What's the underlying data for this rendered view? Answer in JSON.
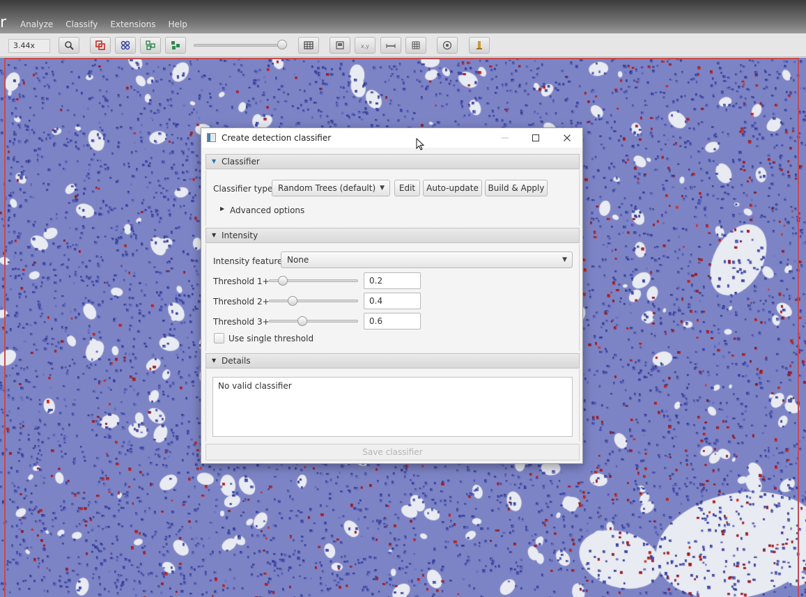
{
  "app": {
    "title_fragment": "r",
    "menu": [
      "Analyze",
      "Classify",
      "Extensions",
      "Help"
    ]
  },
  "toolbar": {
    "zoom": "3.44x",
    "buttons": [
      {
        "icon": "zoom-fit-icon"
      },
      {
        "icon": "show-annotations-icon"
      },
      {
        "icon": "show-tma-grid-icon"
      },
      {
        "icon": "show-detections-icon"
      },
      {
        "icon": "fill-detections-icon"
      },
      {
        "icon": "table-icon"
      },
      {
        "icon": "overview-icon"
      },
      {
        "icon": "xy-location-icon"
      },
      {
        "icon": "scalebar-icon"
      },
      {
        "icon": "grid-icon"
      },
      {
        "icon": "pixel-classification-icon"
      },
      {
        "icon": "log-icon"
      }
    ]
  },
  "dialog": {
    "title": "Create detection classifier",
    "sections": {
      "classifier": {
        "header": "Classifier",
        "type_label": "Classifier type:",
        "type_value": "Random Trees (default)",
        "edit_label": "Edit",
        "auto_update_label": "Auto-update",
        "build_apply_label": "Build & Apply",
        "advanced_label": "Advanced options"
      },
      "intensity": {
        "header": "Intensity",
        "feature_label": "Intensity feature:",
        "feature_value": "None",
        "thresholds": [
          {
            "label": "Threshold 1+",
            "value": "0.2",
            "level": 0.2
          },
          {
            "label": "Threshold 2+",
            "value": "0.4",
            "level": 0.4
          },
          {
            "label": "Threshold 3+",
            "value": "0.6",
            "level": 0.6
          }
        ],
        "single_threshold_label": "Use single threshold",
        "single_threshold_checked": false
      },
      "details": {
        "header": "Details",
        "text": "No valid classifier"
      }
    },
    "save_label": "Save classifier"
  },
  "colors": {
    "cell_blue": "#5560b8",
    "cell_red": "#b32a2a",
    "background_white": "#e9ebf2"
  }
}
